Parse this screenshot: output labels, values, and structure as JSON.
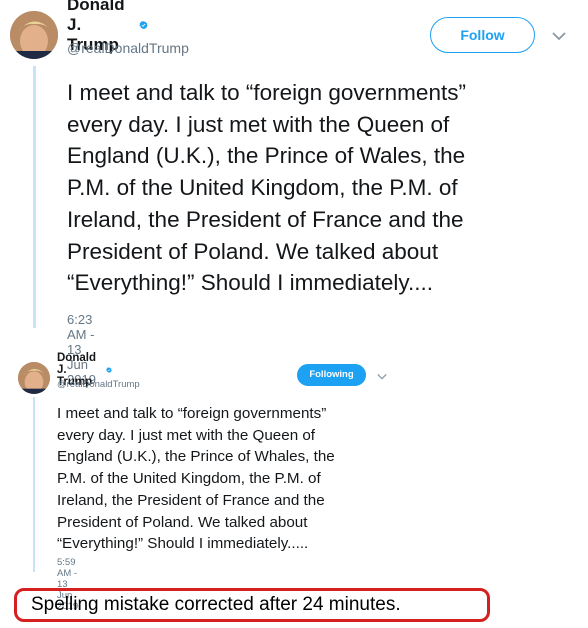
{
  "tweet1": {
    "display_name": "Donald J. Trump",
    "handle": "@realDonaldTrump",
    "follow_label": "Follow",
    "text": "I meet and talk to “foreign governments”\nevery day. I just met with the Queen of\nEngland (U.K.), the Prince of Wales, the\nP.M. of the United Kingdom, the P.M. of\nIreland, the President of France and the\nPresident of Poland. We talked about\n“Everything!” Should I immediately....",
    "timestamp": "6:23 AM - 13 Jun 2019"
  },
  "tweet2": {
    "display_name": "Donald J. Trump",
    "handle": "@realDonaldTrump",
    "follow_label": "Following",
    "text": "I meet and talk to “foreign governments”\nevery day. I just met with the Queen of\nEngland (U.K.), the Prince of Whales, the\nP.M. of the United Kingdom, the P.M. of\nIreland, the President of France and the\nPresident of Poland. We talked about\n“Everything!” Should I immediately.....",
    "timestamp": "5:59 AM - 13 Jun 2019"
  },
  "caption": "Spelling mistake corrected after 24 minutes.",
  "colors": {
    "accent": "#1da1f2",
    "caption_border": "#d62020",
    "muted": "#657786"
  },
  "icons": [
    "verified-badge-icon",
    "chevron-down-icon"
  ]
}
